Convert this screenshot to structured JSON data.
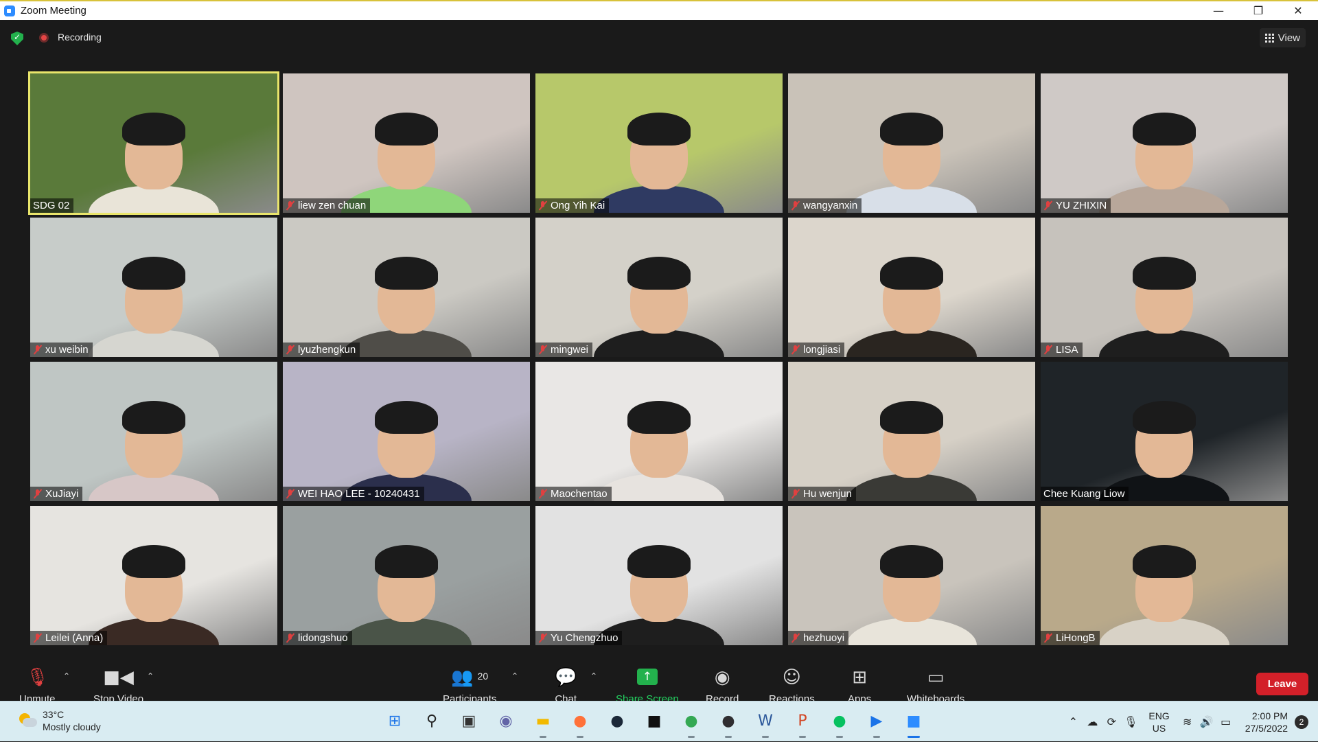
{
  "window": {
    "title": "Zoom Meeting",
    "minimize": "—",
    "restore": "❐",
    "close": "✕"
  },
  "topbar": {
    "recording_label": "Recording",
    "view_label": "View"
  },
  "participants": [
    {
      "name": "SDG 02",
      "muted": false,
      "active": true,
      "bg": "#5a7a3a",
      "body": "#e9e4d8"
    },
    {
      "name": "liew zen chuan",
      "muted": true,
      "bg": "#cfc5c0",
      "body": "#8fd67a"
    },
    {
      "name": "Ong Yih Kai",
      "muted": true,
      "bg": "#b7c86a",
      "body": "#2f3a62"
    },
    {
      "name": "wangyanxin",
      "muted": true,
      "bg": "#c9c2b8",
      "body": "#d8dfe8"
    },
    {
      "name": "YU ZHIXIN",
      "muted": true,
      "bg": "#cfc9c6",
      "body": "#b8a79a"
    },
    {
      "name": "xu weibin",
      "muted": true,
      "bg": "#c7ccc9",
      "body": "#d6d6d0"
    },
    {
      "name": "lyuzhengkun",
      "muted": true,
      "bg": "#cbc9c3",
      "body": "#4f4d48"
    },
    {
      "name": "mingwei",
      "muted": true,
      "bg": "#d4d1c9",
      "body": "#1e1e1e"
    },
    {
      "name": "longjiasi",
      "muted": true,
      "bg": "#dcd6cc",
      "body": "#2a2520"
    },
    {
      "name": "LISA",
      "muted": true,
      "bg": "#c6c2bc",
      "body": "#1e1e1e"
    },
    {
      "name": "XuJiayi",
      "muted": true,
      "bg": "#bfc6c4",
      "body": "#d7c7c7"
    },
    {
      "name": "WEI HAO LEE - 10240431",
      "muted": true,
      "bg": "#b8b4c6",
      "body": "#2b2f4c"
    },
    {
      "name": "Maochentao",
      "muted": true,
      "bg": "#e9e7e5",
      "body": "#e7e3df"
    },
    {
      "name": "Hu wenjun",
      "muted": true,
      "bg": "#d6d0c6",
      "body": "#3a3a36"
    },
    {
      "name": "Chee Kuang Liow",
      "muted": false,
      "bg": "#1f2428",
      "body": "#101316"
    },
    {
      "name": "Leilei  (Anna)",
      "muted": true,
      "bg": "#e6e4e0",
      "body": "#3a2a24"
    },
    {
      "name": "lidongshuo",
      "muted": true,
      "bg": "#9aa0a0",
      "body": "#4a5448"
    },
    {
      "name": "Yu Chengzhuo",
      "muted": true,
      "bg": "#e2e2e2",
      "body": "#1e1e1e"
    },
    {
      "name": "hezhuoyi",
      "muted": true,
      "bg": "#c9c4bc",
      "body": "#e8e4da"
    },
    {
      "name": "LiHongB",
      "muted": true,
      "bg": "#b9a98a",
      "body": "#d8d2c6"
    }
  ],
  "toolbar": {
    "unmute": "Unmute",
    "stop_video": "Stop Video",
    "participants": "Participants",
    "participants_count": "20",
    "chat": "Chat",
    "share_screen": "Share Screen",
    "record": "Record",
    "reactions": "Reactions",
    "apps": "Apps",
    "whiteboards": "Whiteboards",
    "leave": "Leave"
  },
  "taskbar": {
    "temperature": "33°C",
    "weather": "Mostly cloudy",
    "lang_1": "ENG",
    "lang_2": "US",
    "time": "2:00 PM",
    "date": "27/5/2022",
    "notifications": "2",
    "apps": [
      {
        "name": "start-icon",
        "glyph": "⊞",
        "color": "#1a73e8",
        "bg": "transparent",
        "running": false
      },
      {
        "name": "search-icon",
        "glyph": "⚲",
        "color": "#222",
        "bg": "transparent",
        "running": false
      },
      {
        "name": "task-view-icon",
        "glyph": "▣",
        "color": "#333",
        "bg": "transparent",
        "running": false
      },
      {
        "name": "teams-chat-icon",
        "glyph": "◉",
        "color": "#6264a7",
        "bg": "transparent",
        "running": false
      },
      {
        "name": "file-explorer-icon",
        "glyph": "▬",
        "color": "#f2b900",
        "bg": "transparent",
        "running": true
      },
      {
        "name": "firefox-icon",
        "glyph": "●",
        "color": "#ff7139",
        "bg": "transparent",
        "running": true
      },
      {
        "name": "steam-icon",
        "glyph": "●",
        "color": "#1b2838",
        "bg": "transparent",
        "running": false
      },
      {
        "name": "epic-games-icon",
        "glyph": "■",
        "color": "#111",
        "bg": "transparent",
        "running": false
      },
      {
        "name": "chrome-icon",
        "glyph": "●",
        "color": "#34a853",
        "bg": "transparent",
        "running": true
      },
      {
        "name": "obs-icon",
        "glyph": "●",
        "color": "#302e31",
        "bg": "transparent",
        "running": true
      },
      {
        "name": "word-icon",
        "glyph": "W",
        "color": "#2b579a",
        "bg": "transparent",
        "running": true
      },
      {
        "name": "powerpoint-icon",
        "glyph": "P",
        "color": "#d24726",
        "bg": "transparent",
        "running": true
      },
      {
        "name": "wechat-icon",
        "glyph": "●",
        "color": "#07c160",
        "bg": "transparent",
        "running": true
      },
      {
        "name": "media-player-icon",
        "glyph": "▶",
        "color": "#1a73e8",
        "bg": "transparent",
        "running": true
      },
      {
        "name": "zoom-icon",
        "glyph": "■",
        "color": "#2d8cff",
        "bg": "transparent",
        "running": true,
        "focused": true
      }
    ]
  },
  "colors": {
    "accent_green": "#23b14d",
    "leave_red": "#d32029",
    "active_speaker": "#e9e56b"
  }
}
